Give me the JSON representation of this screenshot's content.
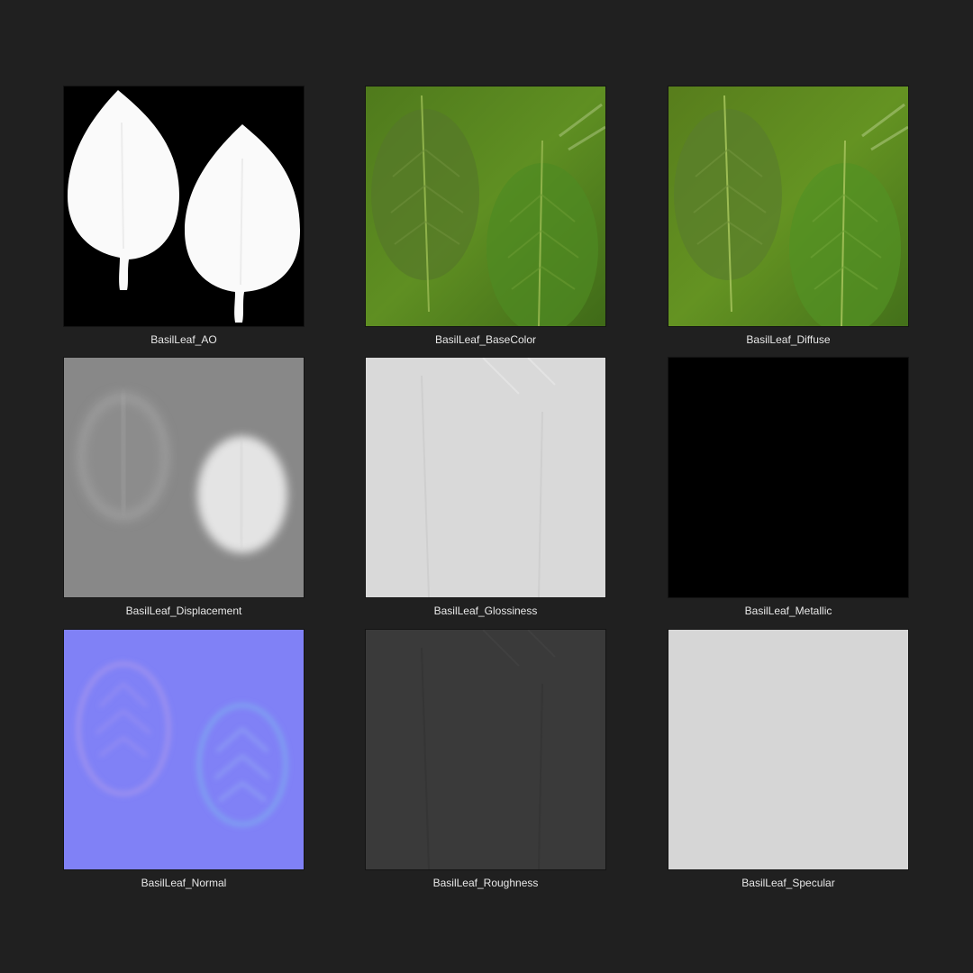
{
  "textures": [
    {
      "label": "BasilLeaf_AO"
    },
    {
      "label": "BasilLeaf_BaseColor"
    },
    {
      "label": "BasilLeaf_Diffuse"
    },
    {
      "label": "BasilLeaf_Displacement"
    },
    {
      "label": "BasilLeaf_Glossiness"
    },
    {
      "label": "BasilLeaf_Metallic"
    },
    {
      "label": "BasilLeaf_Normal"
    },
    {
      "label": "BasilLeaf_Roughness"
    },
    {
      "label": "BasilLeaf_Specular"
    }
  ],
  "colors": {
    "background": "#202020",
    "caption": "#e8e8e8",
    "leaf_green": "#5f8f22",
    "normal_blue": "#8081f6",
    "metallic": "#000000",
    "specular": "#d6d6d6"
  }
}
